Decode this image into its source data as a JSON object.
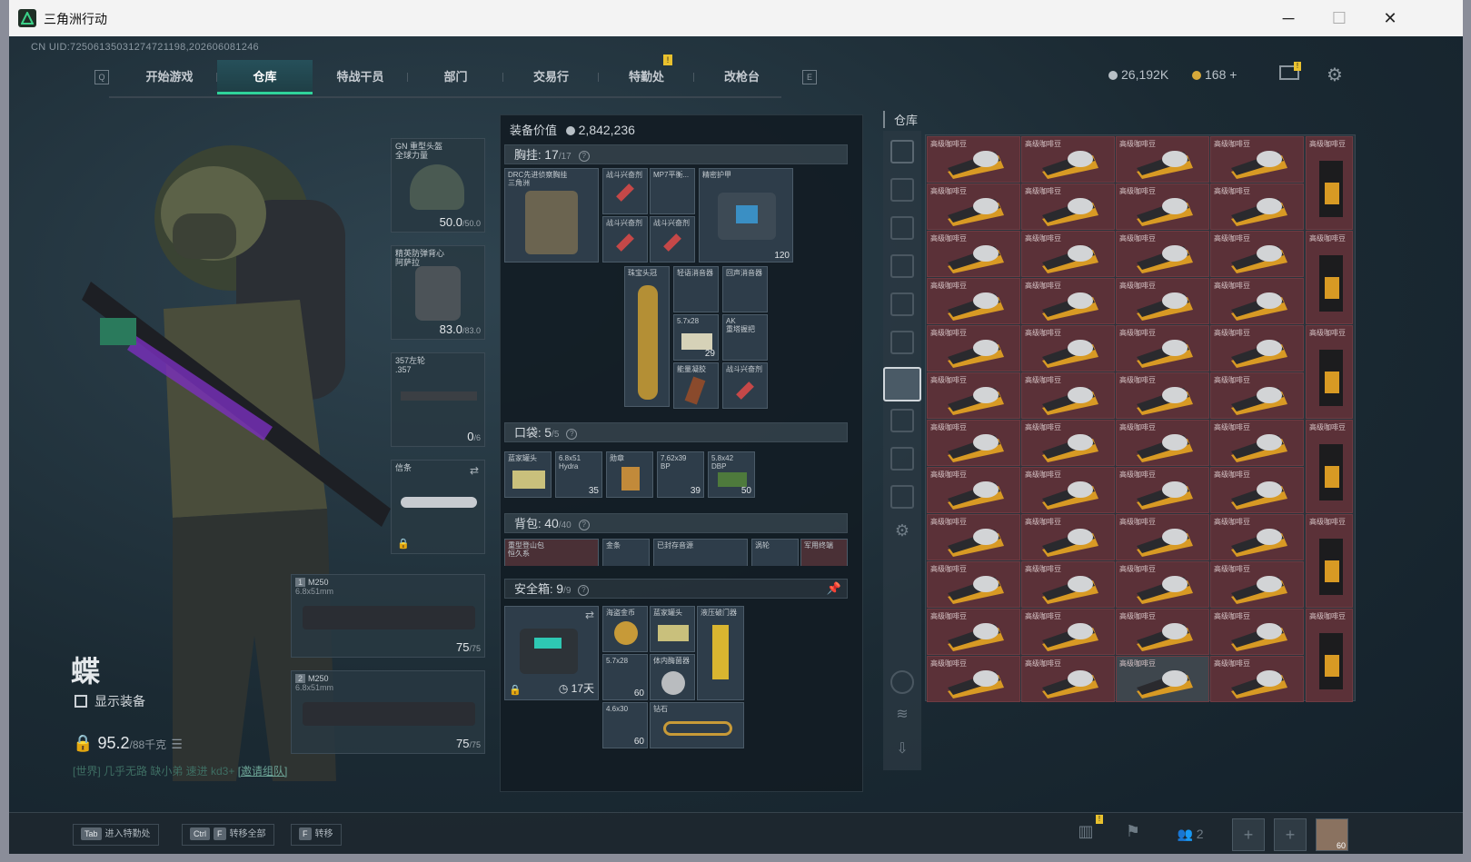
{
  "window": {
    "title": "三角洲行动",
    "minimize": "─",
    "maximize": "☐",
    "close": "✕"
  },
  "uid": "CN UID:7250613503127472119​8,202606081246",
  "nav": {
    "left_key": "Q",
    "right_key": "E",
    "tabs": [
      {
        "label": "开始游戏"
      },
      {
        "label": "仓库"
      },
      {
        "label": "特战干员"
      },
      {
        "label": "部门"
      },
      {
        "label": "交易行"
      },
      {
        "label": "特勤处"
      },
      {
        "label": "改枪台"
      }
    ],
    "badge": "!"
  },
  "currency": {
    "silver": "26,192K",
    "gold": "168",
    "plus": "+",
    "mail_badge": "!"
  },
  "character": {
    "name": "蝶",
    "show_equipment": "显示装备",
    "weight_value": "95.2",
    "weight_max": "/88千克",
    "team_line": "[世界] 几乎无路 缺小弟 速进 kd3+",
    "team_invite": "[邀请组队]"
  },
  "slots": {
    "helmet": {
      "label": "GN 重型头盔\n全球力量",
      "dur": "50.0",
      "max": "/50.0"
    },
    "armor": {
      "label": "精英防弹背心\n阿萨拉",
      "dur": "83.0",
      "max": "/83.0"
    },
    "pistol": {
      "label": "357左轮\n.357",
      "dur": "0",
      "max": "/6"
    },
    "melee": {
      "label": "信条"
    },
    "primary1": {
      "index": "1",
      "name": "M250",
      "caliber": "6.8x51mm",
      "ammo": "75",
      "max": "/75"
    },
    "primary2": {
      "index": "2",
      "name": "M250",
      "caliber": "6.8x51mm",
      "ammo": "75",
      "max": "/75"
    }
  },
  "equipment_value": {
    "label": "装备价值",
    "value": "2,842,236"
  },
  "chest": {
    "title": "胸挂:",
    "count": "17",
    "max": "/17",
    "items": [
      {
        "label": "DRC先进侦察胸挂\n三角洲"
      },
      {
        "label": "战斗兴奋剂"
      },
      {
        "label": "MP7平衡..."
      },
      {
        "label": "战斗兴奋剂"
      },
      {
        "label": "战斗兴奋剂"
      },
      {
        "label": "精密护甲",
        "n": "120"
      },
      {
        "label": "珠宝头冠"
      },
      {
        "label": "轻语消音器"
      },
      {
        "label": "回声消音器"
      },
      {
        "label": "5.7x28",
        "n": "29"
      },
      {
        "label": "AK\n重塔握把"
      },
      {
        "label": "能量凝胶"
      },
      {
        "label": "战斗兴奋剂"
      }
    ]
  },
  "pocket": {
    "title": "口袋:",
    "count": "5",
    "max": "/5",
    "items": [
      {
        "label": "蓝家罐头"
      },
      {
        "label": "6.8x51\nHydra",
        "n": "35"
      },
      {
        "label": "勋章"
      },
      {
        "label": "7.62x39\nBP",
        "n": "39"
      },
      {
        "label": "5.8x42\nDBP",
        "n": "50"
      }
    ]
  },
  "backpack": {
    "title": "背包:",
    "count": "40",
    "max": "/40",
    "items": [
      {
        "label": "重型登山包\n恒久系"
      },
      {
        "label": "金条"
      },
      {
        "label": "已封存音源"
      },
      {
        "label": "涡轮"
      },
      {
        "label": "军用终端"
      }
    ]
  },
  "safebox": {
    "title": "安全箱:",
    "count": "9",
    "max": "/9",
    "timer": "17天",
    "items": [
      {
        "label": "海盗金币"
      },
      {
        "label": "蓝家罐头"
      },
      {
        "label": "液压破门器"
      },
      {
        "label": "5.7x28",
        "n": "60"
      },
      {
        "label": "体内酶菌器"
      },
      {
        "label": "4.6x30",
        "n": "60"
      },
      {
        "label": "钻石"
      }
    ]
  },
  "warehouse": {
    "title": "仓库",
    "item_label": "高级咖啡豆",
    "colors": {
      "cell_bg": "#5b3138",
      "gold": "#d89a24"
    }
  },
  "bottom": {
    "hints": [
      {
        "key": "Tab",
        "key2": "",
        "text": "进入特勤处"
      },
      {
        "key": "Ctrl",
        "key2": "F",
        "text": "转移全部"
      },
      {
        "key": "F",
        "key2": "",
        "text": "转移"
      }
    ],
    "squad_count": "2",
    "avatar_level": "60",
    "badge": "!"
  }
}
